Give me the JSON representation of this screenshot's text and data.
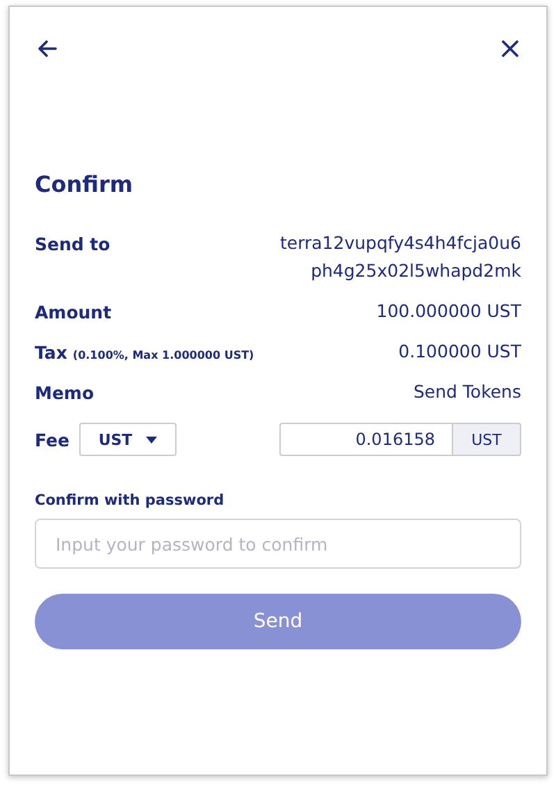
{
  "title": "Confirm",
  "details": [
    {
      "label": "Send to",
      "value_lines": [
        "terra12vupqfy4s4h4fcja0u6",
        "ph4g25x02l5whapd2mk"
      ]
    },
    {
      "label": "Amount",
      "value_lines": [
        "100.000000 UST"
      ]
    },
    {
      "label": "Tax",
      "note": "(0.100%, Max 1.000000 UST)",
      "value_lines": [
        "0.100000 UST"
      ]
    },
    {
      "label": "Memo",
      "value_lines": [
        "Send Tokens"
      ]
    }
  ],
  "fee": {
    "label": "Fee",
    "denom": "UST",
    "amount": "0.016158",
    "unit": "UST"
  },
  "password": {
    "label": "Confirm with password",
    "placeholder": "Input your password to confirm"
  },
  "send_button": {
    "label": "Send",
    "disabled": true
  }
}
